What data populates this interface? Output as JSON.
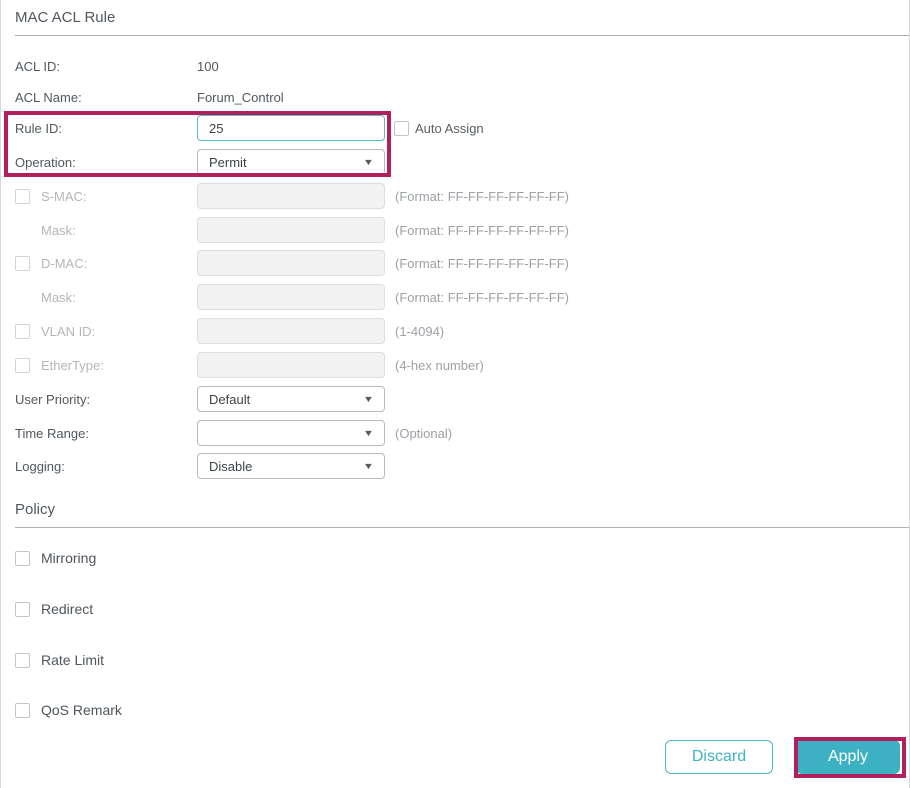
{
  "page": {
    "title": "MAC ACL Rule"
  },
  "icons": {
    "dropdown_arrow": "▼"
  },
  "colors": {
    "accent_teal": "#3cb1c3",
    "annotation_magenta": "#b1205c"
  },
  "form": {
    "acl_id": {
      "label": "ACL ID:",
      "value": "100"
    },
    "acl_name": {
      "label": "ACL Name:",
      "value": "Forum_Control"
    },
    "rule_id": {
      "label": "Rule ID:",
      "value": "25",
      "auto_assign_label": "Auto Assign"
    },
    "operation": {
      "label": "Operation:",
      "value": "Permit"
    },
    "smac": {
      "label": "S-MAC:",
      "value": "",
      "hint": "(Format: FF-FF-FF-FF-FF-FF)"
    },
    "smac_mask": {
      "label": "Mask:",
      "value": "",
      "hint": "(Format: FF-FF-FF-FF-FF-FF)"
    },
    "dmac": {
      "label": "D-MAC:",
      "value": "",
      "hint": "(Format: FF-FF-FF-FF-FF-FF)"
    },
    "dmac_mask": {
      "label": "Mask:",
      "value": "",
      "hint": "(Format: FF-FF-FF-FF-FF-FF)"
    },
    "vlan_id": {
      "label": "VLAN ID:",
      "value": "",
      "hint": "(1-4094)"
    },
    "ethertype": {
      "label": "EtherType:",
      "value": "",
      "hint": "(4-hex number)"
    },
    "user_priority": {
      "label": "User Priority:",
      "value": "Default"
    },
    "time_range": {
      "label": "Time Range:",
      "value": "",
      "hint": "(Optional)"
    },
    "logging": {
      "label": "Logging:",
      "value": "Disable"
    }
  },
  "policy": {
    "heading": "Policy",
    "options": [
      "Mirroring",
      "Redirect",
      "Rate Limit",
      "QoS Remark"
    ]
  },
  "footer": {
    "discard": "Discard",
    "apply": "Apply"
  }
}
